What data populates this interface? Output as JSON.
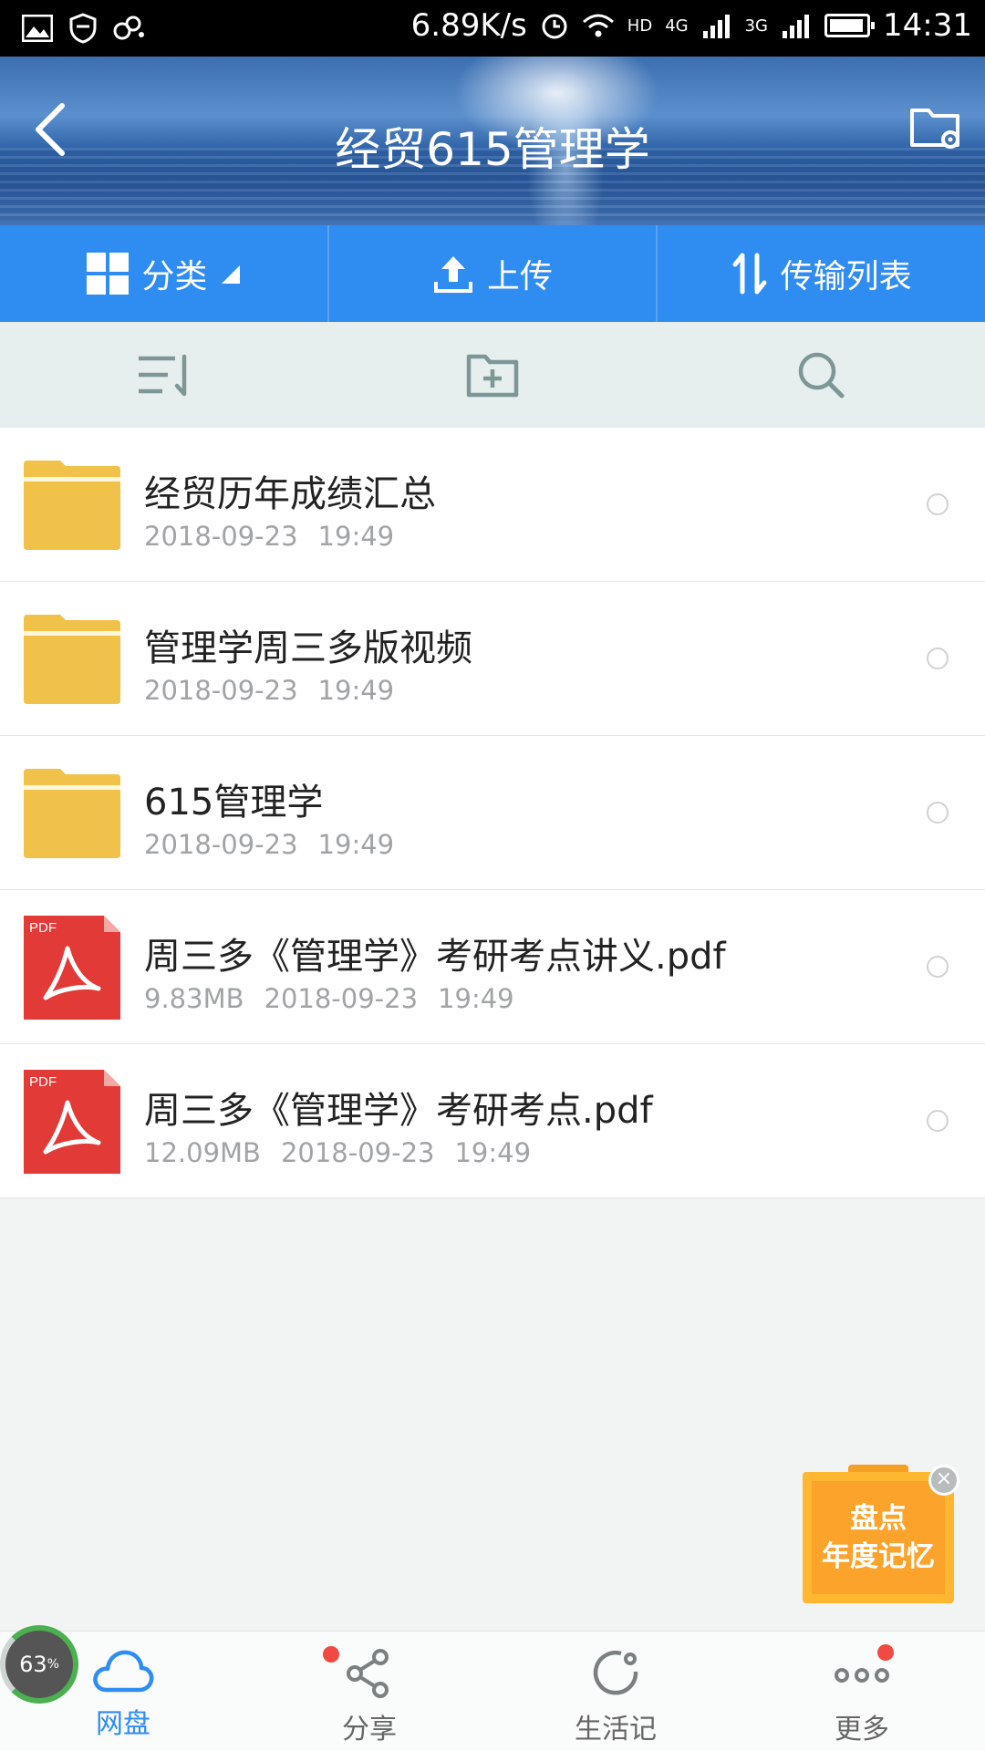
{
  "status_bar": {
    "speed": "6.89K/s",
    "net_hd": "HD",
    "net_4g": "4G",
    "net_3g": "3G",
    "time": "14:31"
  },
  "header": {
    "title": "经贸615管理学"
  },
  "toolbar": {
    "category_label": "分类",
    "upload_label": "上传",
    "transfer_label": "传输列表"
  },
  "files": [
    {
      "name": "经贸历年成绩汇总",
      "type": "folder",
      "size": "",
      "date": "2018-09-23",
      "time": "19:49"
    },
    {
      "name": "管理学周三多版视频",
      "type": "folder",
      "size": "",
      "date": "2018-09-23",
      "time": "19:49"
    },
    {
      "name": "615管理学",
      "type": "folder",
      "size": "",
      "date": "2018-09-23",
      "time": "19:49"
    },
    {
      "name": "周三多《管理学》考研考点讲义.pdf",
      "type": "pdf",
      "size": "9.83MB",
      "date": "2018-09-23",
      "time": "19:49"
    },
    {
      "name": "周三多《管理学》考研考点.pdf",
      "type": "pdf",
      "size": "12.09MB",
      "date": "2018-09-23",
      "time": "19:49"
    }
  ],
  "pdf_badge": "PDF",
  "promo": {
    "line1": "盘点",
    "line2": "年度记忆"
  },
  "progress": {
    "value": "63",
    "unit": "%"
  },
  "bottom_nav": {
    "netdisk": "网盘",
    "share": "分享",
    "life": "生活记",
    "more": "更多"
  },
  "colors": {
    "accent": "#2f8cf0",
    "folder": "#f1c24a",
    "pdf": "#e23a36",
    "badge": "#f04a43"
  }
}
